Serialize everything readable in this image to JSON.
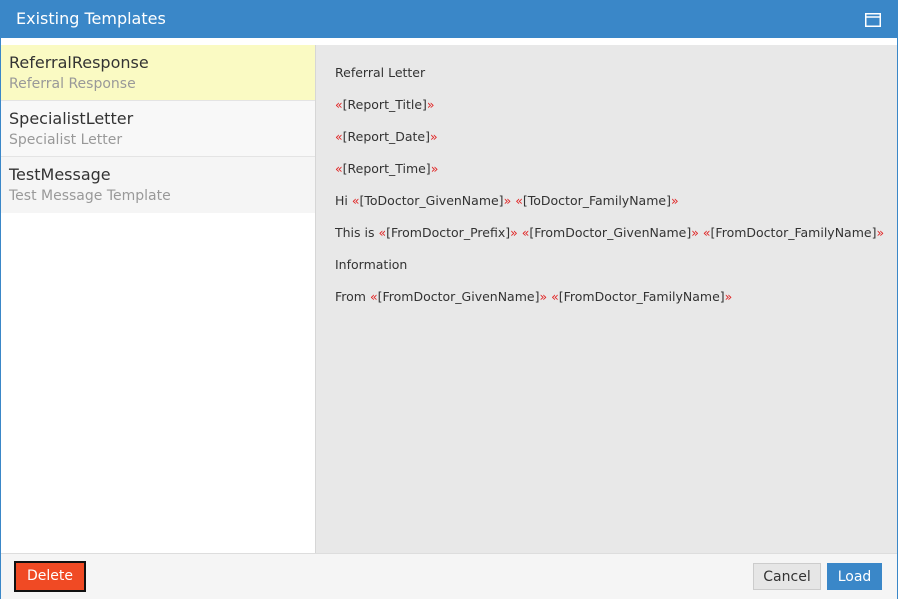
{
  "dialog": {
    "title": "Existing Templates"
  },
  "templates": [
    {
      "name": "ReferralResponse",
      "description": "Referral Response",
      "selected": true
    },
    {
      "name": "SpecialistLetter",
      "description": "Specialist Letter",
      "selected": false
    },
    {
      "name": "TestMessage",
      "description": "Test Message Template",
      "selected": false
    }
  ],
  "preview": {
    "lines": [
      [
        "Referral Letter"
      ],
      [
        "«",
        "[Report_Title]",
        "»"
      ],
      [
        "«",
        "[Report_Date]",
        "»"
      ],
      [
        "«",
        "[Report_Time]",
        "»"
      ],
      [
        "Hi ",
        "«",
        "[ToDoctor_GivenName]",
        "»",
        " ",
        "«",
        "[ToDoctor_FamilyName]",
        "»"
      ],
      [
        "This is ",
        "«",
        "[FromDoctor_Prefix]",
        "»",
        " ",
        "«",
        "[FromDoctor_GivenName]",
        "»",
        " ",
        "«",
        "[FromDoctor_FamilyName]",
        "»"
      ],
      [
        "Information"
      ],
      [
        "From ",
        "«",
        "[FromDoctor_GivenName]",
        "»",
        " ",
        "«",
        "[FromDoctor_FamilyName]",
        "»"
      ]
    ]
  },
  "footer": {
    "delete_label": "Delete",
    "cancel_label": "Cancel",
    "load_label": "Load"
  },
  "colors": {
    "accent": "#3a87c8",
    "selected_row": "#fafac3",
    "delete": "#f04a24",
    "merge_field_marker": "#e02424"
  },
  "icons": {
    "maximize": "window-maximize-icon"
  }
}
